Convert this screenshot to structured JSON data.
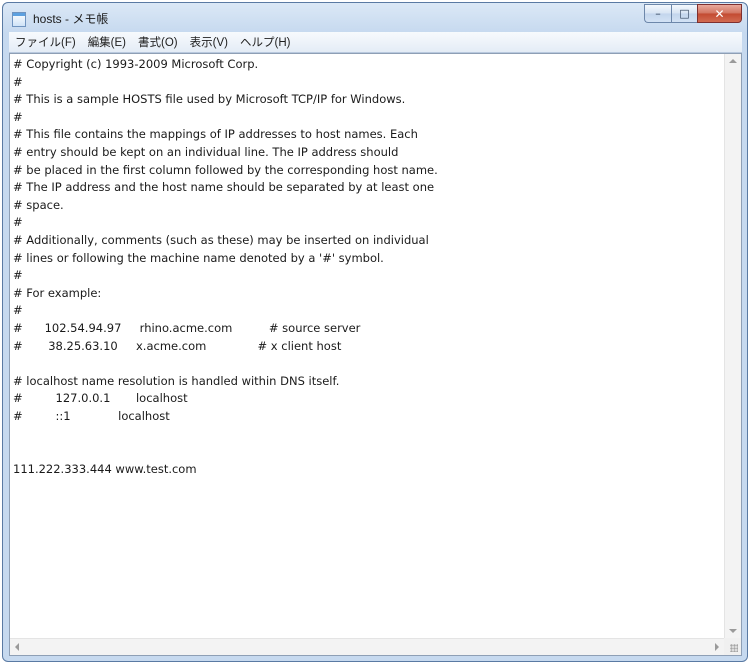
{
  "window": {
    "title": "hosts - メモ帳"
  },
  "caption_buttons": {
    "minimize": "–",
    "maximize": "□",
    "close": "✕"
  },
  "menu": {
    "items": [
      "ファイル(F)",
      "編集(E)",
      "書式(O)",
      "表示(V)",
      "ヘルプ(H)"
    ]
  },
  "document": {
    "lines": [
      "# Copyright (c) 1993-2009 Microsoft Corp.",
      "#",
      "# This is a sample HOSTS file used by Microsoft TCP/IP for Windows.",
      "#",
      "# This file contains the mappings of IP addresses to host names. Each",
      "# entry should be kept on an individual line. The IP address should",
      "# be placed in the first column followed by the corresponding host name.",
      "# The IP address and the host name should be separated by at least one",
      "# space.",
      "#",
      "# Additionally, comments (such as these) may be inserted on individual",
      "# lines or following the machine name denoted by a '#' symbol.",
      "#",
      "# For example:",
      "#",
      "#      102.54.94.97     rhino.acme.com          # source server",
      "#       38.25.63.10     x.acme.com              # x client host",
      "",
      "# localhost name resolution is handled within DNS itself.",
      "#         127.0.0.1       localhost",
      "#         ::1             localhost",
      "",
      "",
      "111.222.333.444 www.test.com"
    ]
  },
  "colors": {
    "titlebar": "#c6d9ef",
    "close_button": "#c24a31",
    "editor_background": "#ffffff"
  }
}
